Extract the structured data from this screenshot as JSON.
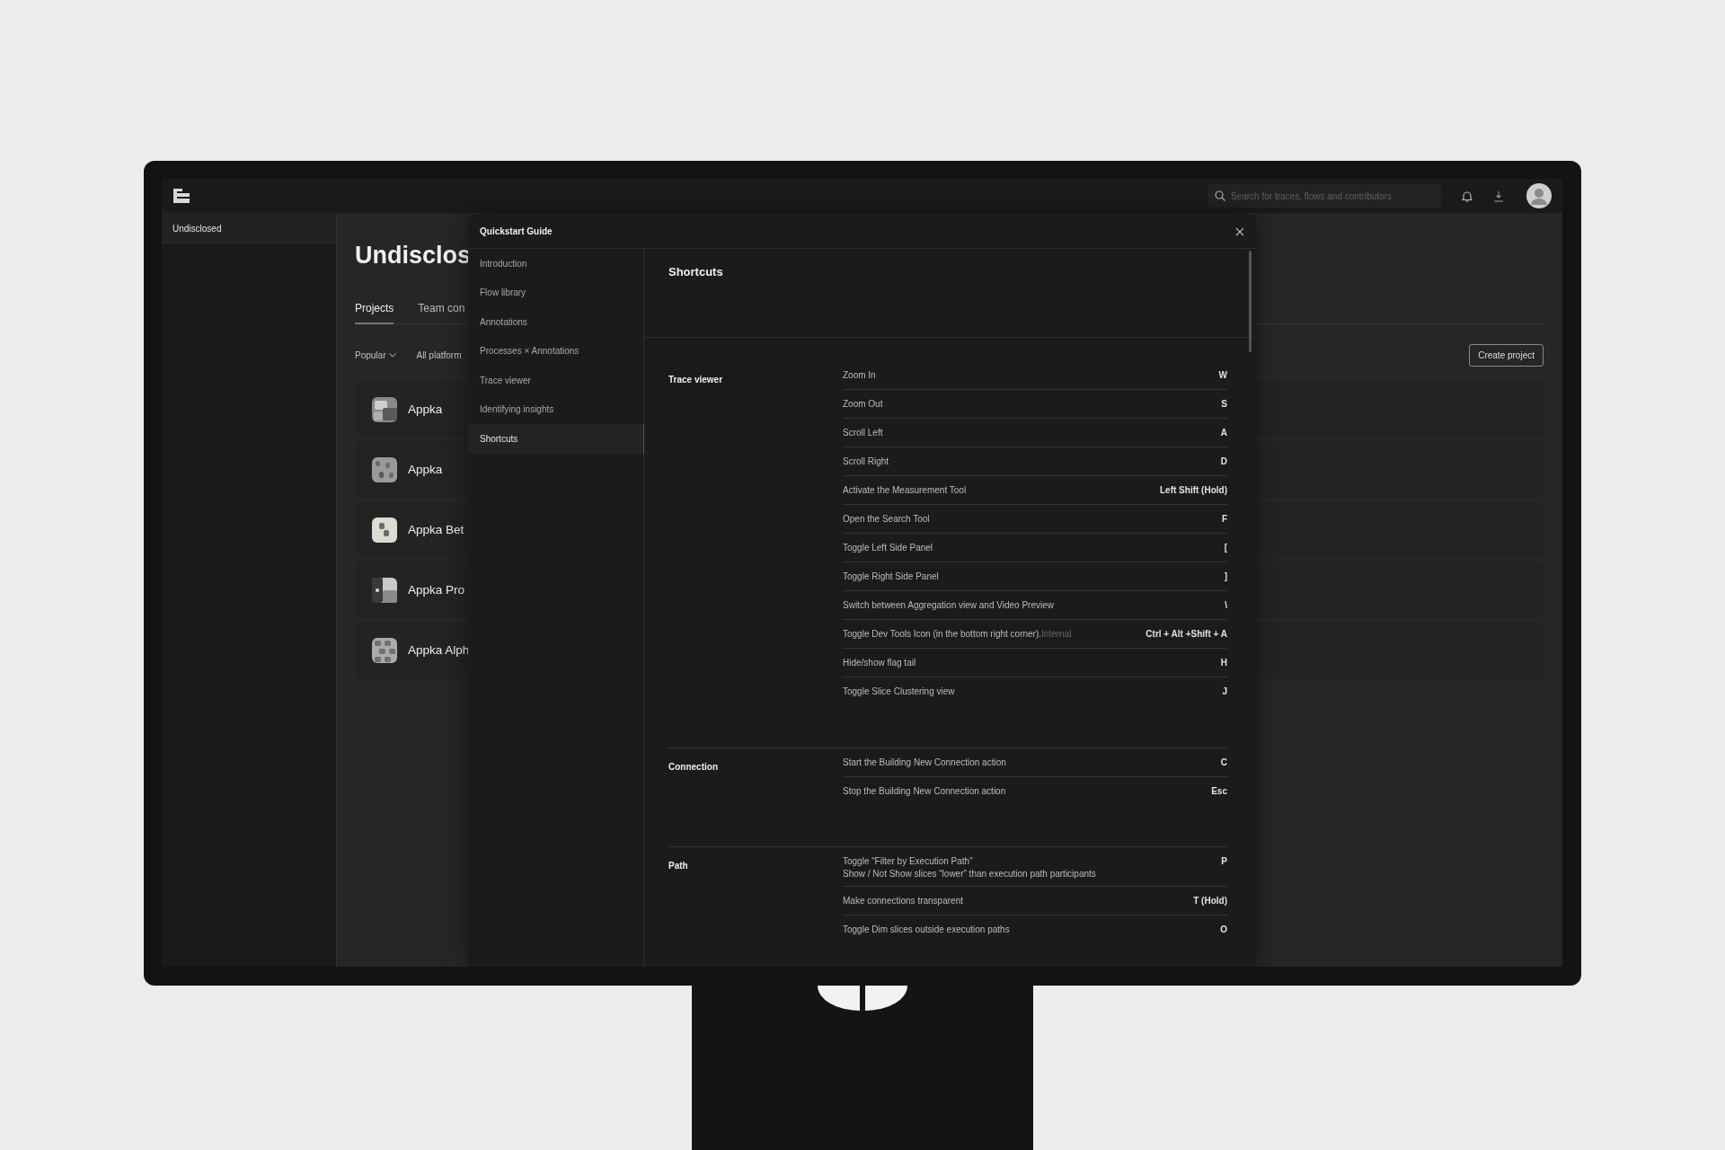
{
  "top_bar": {
    "search": {
      "placeholder": "Search for traces, flows and contributors"
    }
  },
  "sidebar": {
    "items": [
      {
        "label": "Undisclosed",
        "selected": true
      }
    ]
  },
  "main": {
    "title": "Undisclos",
    "tabs": [
      {
        "label": "Projects",
        "selected": true
      },
      {
        "label": "Team con",
        "selected": false
      }
    ],
    "filters": [
      {
        "label": "Popular",
        "kind": "dropdown"
      },
      {
        "label": "All platform",
        "kind": "plain"
      }
    ],
    "create_button": "Create project",
    "projects": [
      {
        "name": "Appka"
      },
      {
        "name": "Appka"
      },
      {
        "name": "Appka Bet"
      },
      {
        "name": "Appka Pro"
      },
      {
        "name": "Appka Alph"
      }
    ]
  },
  "modal": {
    "title": "Quickstart Guide",
    "nav": [
      {
        "label": "Introduction",
        "selected": false
      },
      {
        "label": "Flow library",
        "selected": false
      },
      {
        "label": "Annotations",
        "selected": false
      },
      {
        "label": "Processes × Annotations",
        "selected": false
      },
      {
        "label": "Trace viewer",
        "selected": false
      },
      {
        "label": "Identifying insights",
        "selected": false
      },
      {
        "label": "Shortcuts",
        "selected": true
      }
    ],
    "heading": "Shortcuts",
    "sections": [
      {
        "title": "Trace viewer",
        "shortcuts": [
          {
            "action": "Zoom In",
            "key": "W"
          },
          {
            "action": "Zoom Out",
            "key": "S"
          },
          {
            "action": "Scroll Left",
            "key": "A"
          },
          {
            "action": "Scroll Right",
            "key": "D"
          },
          {
            "action": "Activate the Measurement Tool",
            "key": "Left Shift (Hold)"
          },
          {
            "action": "Open the Search Tool",
            "key": "F"
          },
          {
            "action": "Toggle Left Side Panel",
            "key": "["
          },
          {
            "action": "Toggle Right Side Panel",
            "key": "]"
          },
          {
            "action": "Switch between Aggregation view and Video Preview",
            "key": "\\"
          },
          {
            "action": "Toggle Dev Tools Icon (in the bottom right corner).",
            "note": "Internal",
            "key": "Ctrl + Alt +Shift + A"
          },
          {
            "action": "Hide/show flag tail",
            "key": "H"
          },
          {
            "action": "Toggle Slice Clustering view",
            "key": "J"
          }
        ]
      },
      {
        "title": "Connection",
        "shortcuts": [
          {
            "action": "Start the Building New Connection action",
            "key": "C"
          },
          {
            "action": "Stop the Building New Connection action",
            "key": "Esc"
          }
        ]
      },
      {
        "title": "Path",
        "shortcuts": [
          {
            "action": "Toggle “Filter by Execution Path”",
            "detail": "Show / Not Show slices “lower” than execution path participants",
            "key": "P"
          },
          {
            "action": "Make connections transparent",
            "key": "T (Hold)"
          },
          {
            "action": "Toggle Dim slices outside execution paths",
            "key": "O"
          }
        ]
      }
    ]
  }
}
